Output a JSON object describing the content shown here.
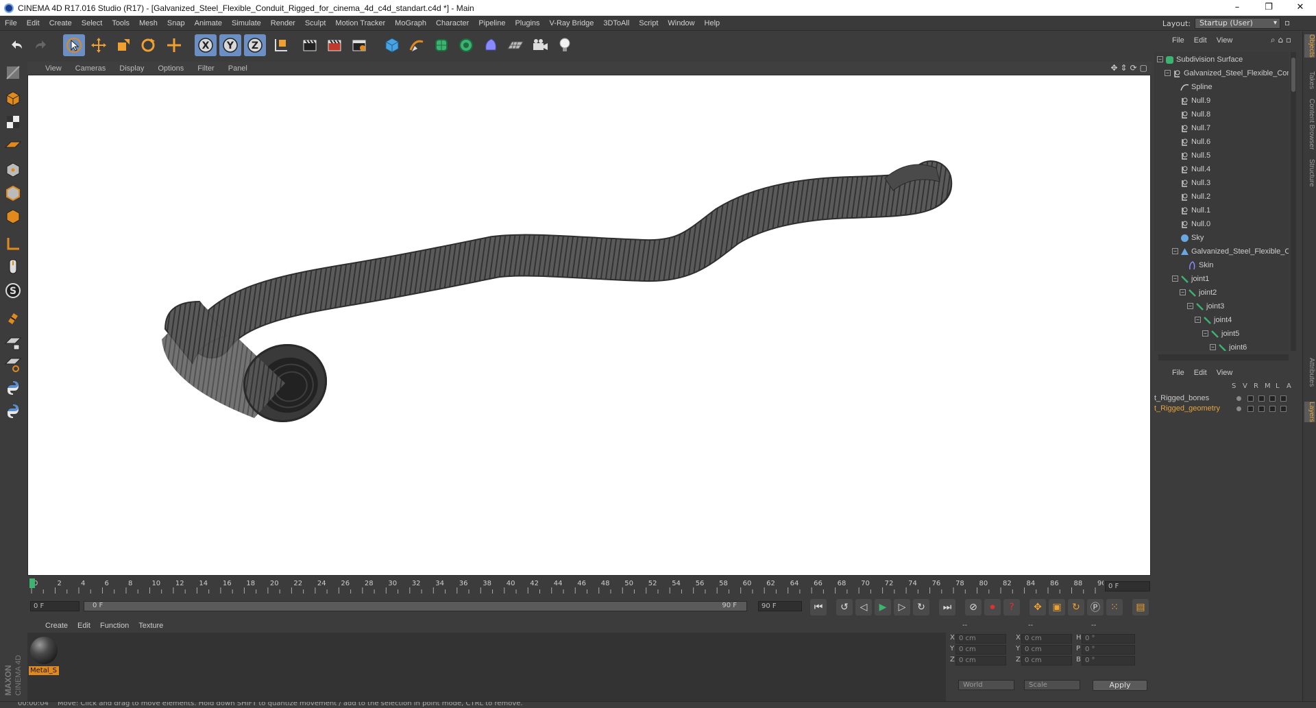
{
  "window": {
    "title": "CINEMA 4D R17.016 Studio (R17) - [Galvanized_Steel_Flexible_Conduit_Rigged_for_cinema_4d_c4d_standart.c4d *] - Main",
    "minimize": "–",
    "restore": "❐",
    "close": "✕"
  },
  "menubar": {
    "items": [
      "File",
      "Edit",
      "Create",
      "Select",
      "Tools",
      "Mesh",
      "Snap",
      "Animate",
      "Simulate",
      "Render",
      "Sculpt",
      "Motion Tracker",
      "MoGraph",
      "Character",
      "Pipeline",
      "Plugins",
      "V-Ray Bridge",
      "3DToAll",
      "Script",
      "Window",
      "Help"
    ],
    "layout_label": "Layout:",
    "layout_value": "Startup (User)"
  },
  "toolbar": {
    "axis_x": "X",
    "axis_y": "Y",
    "axis_z": "Z"
  },
  "viewport": {
    "menu": [
      "View",
      "Cameras",
      "Display",
      "Options",
      "Filter",
      "Panel"
    ]
  },
  "timeline": {
    "ticks": [
      "0",
      "2",
      "4",
      "6",
      "8",
      "10",
      "12",
      "14",
      "16",
      "18",
      "20",
      "22",
      "24",
      "26",
      "28",
      "30",
      "32",
      "34",
      "36",
      "38",
      "40",
      "42",
      "44",
      "46",
      "48",
      "50",
      "52",
      "54",
      "56",
      "58",
      "60",
      "62",
      "64",
      "66",
      "68",
      "70",
      "72",
      "74",
      "76",
      "78",
      "80",
      "82",
      "84",
      "86",
      "88",
      "90"
    ],
    "current_frame": "0 F",
    "start_frame": "0 F",
    "range_start": "0 F",
    "range_end": "90 F",
    "end_frame": "90 F"
  },
  "material_manager": {
    "menu": [
      "Create",
      "Edit",
      "Function",
      "Texture"
    ],
    "material_name": "Metal_S"
  },
  "coordinates": {
    "header": [
      "--",
      "--",
      "--"
    ],
    "rows": [
      {
        "a": "X",
        "av": "0 cm",
        "b": "X",
        "bv": "0 cm",
        "c": "H",
        "cv": "0 °"
      },
      {
        "a": "Y",
        "av": "0 cm",
        "b": "Y",
        "bv": "0 cm",
        "c": "P",
        "cv": "0 °"
      },
      {
        "a": "Z",
        "av": "0 cm",
        "b": "Z",
        "bv": "0 cm",
        "c": "B",
        "cv": "0 °"
      }
    ],
    "world": "World",
    "scale": "Scale",
    "apply": "Apply"
  },
  "object_manager": {
    "menu": [
      "File",
      "Edit",
      "View"
    ],
    "tree": [
      {
        "label": "Subdivision Surface",
        "indent": 0,
        "icon": "subdivision-icon",
        "expander": "−"
      },
      {
        "label": "Galvanized_Steel_Flexible_Conduit",
        "indent": 1,
        "icon": "null-icon",
        "expander": "−"
      },
      {
        "label": "Spline",
        "indent": 2,
        "icon": "spline-icon",
        "expander": ""
      },
      {
        "label": "Null.9",
        "indent": 2,
        "icon": "null-icon",
        "expander": ""
      },
      {
        "label": "Null.8",
        "indent": 2,
        "icon": "null-icon",
        "expander": ""
      },
      {
        "label": "Null.7",
        "indent": 2,
        "icon": "null-icon",
        "expander": ""
      },
      {
        "label": "Null.6",
        "indent": 2,
        "icon": "null-icon",
        "expander": ""
      },
      {
        "label": "Null.5",
        "indent": 2,
        "icon": "null-icon",
        "expander": ""
      },
      {
        "label": "Null.4",
        "indent": 2,
        "icon": "null-icon",
        "expander": ""
      },
      {
        "label": "Null.3",
        "indent": 2,
        "icon": "null-icon",
        "expander": ""
      },
      {
        "label": "Null.2",
        "indent": 2,
        "icon": "null-icon",
        "expander": ""
      },
      {
        "label": "Null.1",
        "indent": 2,
        "icon": "null-icon",
        "expander": ""
      },
      {
        "label": "Null.0",
        "indent": 2,
        "icon": "null-icon",
        "expander": ""
      },
      {
        "label": "Sky",
        "indent": 2,
        "icon": "sky-icon",
        "expander": ""
      },
      {
        "label": "Galvanized_Steel_Flexible_Conduit",
        "indent": 2,
        "icon": "polygon-icon",
        "expander": "−"
      },
      {
        "label": "Skin",
        "indent": 3,
        "icon": "skin-icon",
        "expander": ""
      },
      {
        "label": "joint1",
        "indent": 2,
        "icon": "joint-icon",
        "expander": "−"
      },
      {
        "label": "joint2",
        "indent": 3,
        "icon": "joint-icon",
        "expander": "−"
      },
      {
        "label": "joint3",
        "indent": 4,
        "icon": "joint-icon",
        "expander": "−"
      },
      {
        "label": "joint4",
        "indent": 5,
        "icon": "joint-icon",
        "expander": "−"
      },
      {
        "label": "joint5",
        "indent": 6,
        "icon": "joint-icon",
        "expander": "−"
      },
      {
        "label": "joint6",
        "indent": 7,
        "icon": "joint-icon",
        "expander": "−"
      }
    ]
  },
  "layer_manager": {
    "menu": [
      "File",
      "Edit",
      "View"
    ],
    "columns": [
      "S",
      "V",
      "R",
      "M",
      "L",
      "A"
    ],
    "layers": [
      {
        "name": "t_Rigged_bones",
        "color": "#c8c8c8"
      },
      {
        "name": "t_Rigged_geometry",
        "color": "#e8a43a"
      }
    ]
  },
  "right_tabs": [
    "Objects",
    "Takes",
    "Content Browser",
    "Structure",
    "Attributes",
    "Layers"
  ],
  "status": {
    "time": "00:00:04",
    "message": "Move: Click and drag to move elements. Hold down SHIFT to quantize movement / add to the selection in point mode, CTRL to remove."
  },
  "logo": {
    "line1": "MAXON",
    "line2": "CINEMA 4D"
  },
  "colors": {
    "accent_orange": "#e8a43a",
    "active_tool": "#6b8fc2",
    "panel_bg": "#3c3c3c",
    "viewport_bg": "#ffffff"
  }
}
